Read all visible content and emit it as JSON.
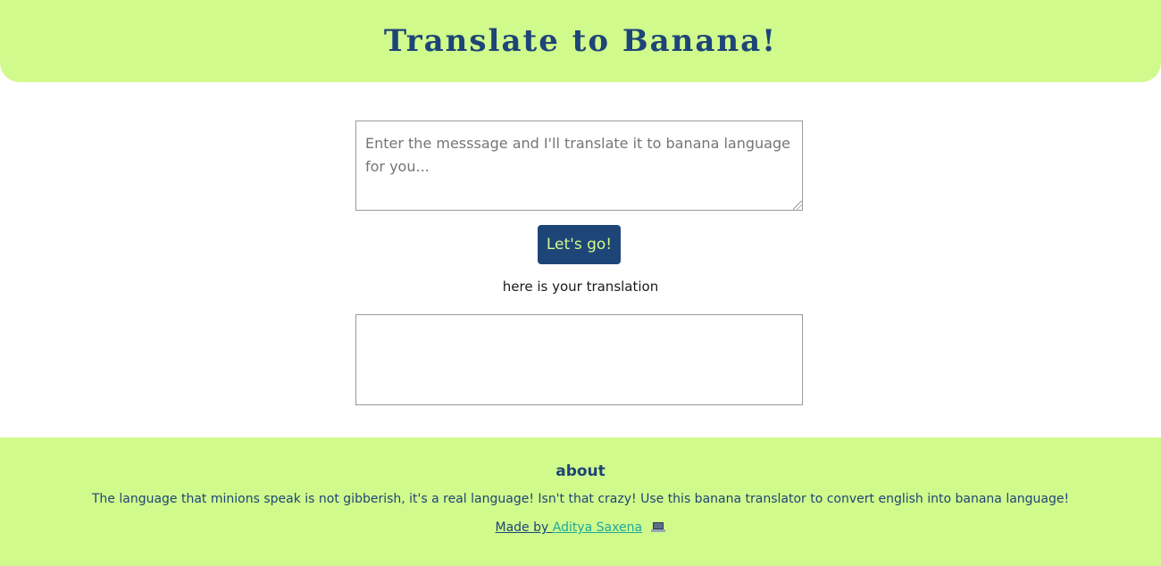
{
  "header": {
    "title": "Translate to Banana!"
  },
  "input": {
    "placeholder": "Enter the messsage and I'll translate it to banana language for you...",
    "value": ""
  },
  "action": {
    "button_label": "Let's go!"
  },
  "output": {
    "label": "here is your translation",
    "value": ""
  },
  "footer": {
    "about_title": "about",
    "about_text": "The language that minions speak is not gibberish, it's a real language! Isn't that crazy! Use this banana translator to convert english into banana language!",
    "made_by_prefix": "Made by ",
    "author_name": "Aditya Saxena",
    "author_icon": "laptop-icon"
  },
  "colors": {
    "accent": "#d1fa8c",
    "primary": "#1e4577",
    "link": "#1fa89a"
  }
}
